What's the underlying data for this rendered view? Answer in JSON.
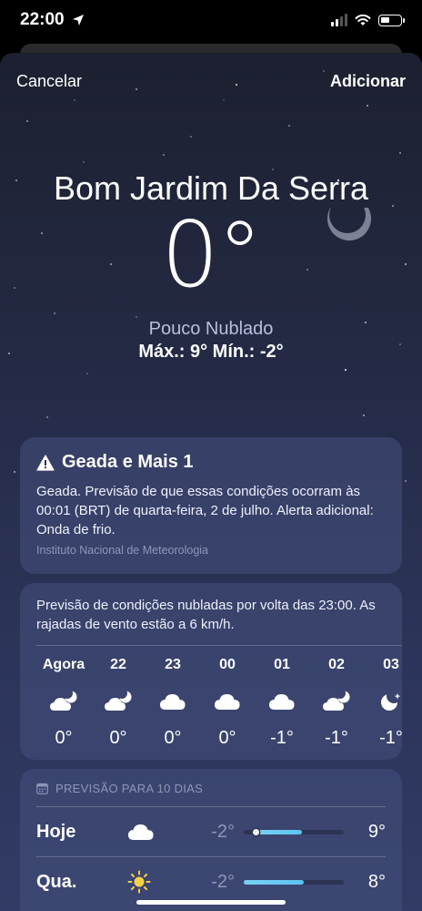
{
  "status_bar": {
    "time": "22:00"
  },
  "nav": {
    "cancel": "Cancelar",
    "add": "Adicionar"
  },
  "hero": {
    "city": "Bom Jardim Da Serra",
    "temperature": "0°",
    "condition": "Pouco Nublado",
    "hilo": "Máx.: 9°  Mín.: -2°"
  },
  "alert": {
    "title": "Geada e Mais 1",
    "text": "Geada. Previsão de que essas condições ocorram às 00:01 (BRT) de quarta-feira, 2 de julho. Alerta adicional: Onda de frio.",
    "source": "Instituto Nacional de Meteorologia"
  },
  "hourly": {
    "summary": "Previsão de condições nubladas por volta das 23:00. As rajadas de vento estão a 6 km/h.",
    "hours": [
      {
        "label": "Agora",
        "icon": "cloud-moon-icon",
        "temp": "0°"
      },
      {
        "label": "22",
        "icon": "cloud-moon-icon",
        "temp": "0°"
      },
      {
        "label": "23",
        "icon": "cloud-icon",
        "temp": "0°"
      },
      {
        "label": "00",
        "icon": "cloud-icon",
        "temp": "0°"
      },
      {
        "label": "01",
        "icon": "cloud-icon",
        "temp": "-1°"
      },
      {
        "label": "02",
        "icon": "cloud-moon-icon",
        "temp": "-1°"
      },
      {
        "label": "03",
        "icon": "moon-stars-icon",
        "temp": "-1°"
      }
    ]
  },
  "daily": {
    "header": "PREVISÃO PARA 10 DIAS",
    "days": [
      {
        "name": "Hoje",
        "icon": "cloud-icon",
        "low": "-2°",
        "high": "9°",
        "range_start": 0.12,
        "range_end": 0.58,
        "current": 0.12
      },
      {
        "name": "Qua.",
        "icon": "sun-icon",
        "low": "-2°",
        "high": "8°",
        "range_start": 0.0,
        "range_end": 0.6
      }
    ]
  }
}
